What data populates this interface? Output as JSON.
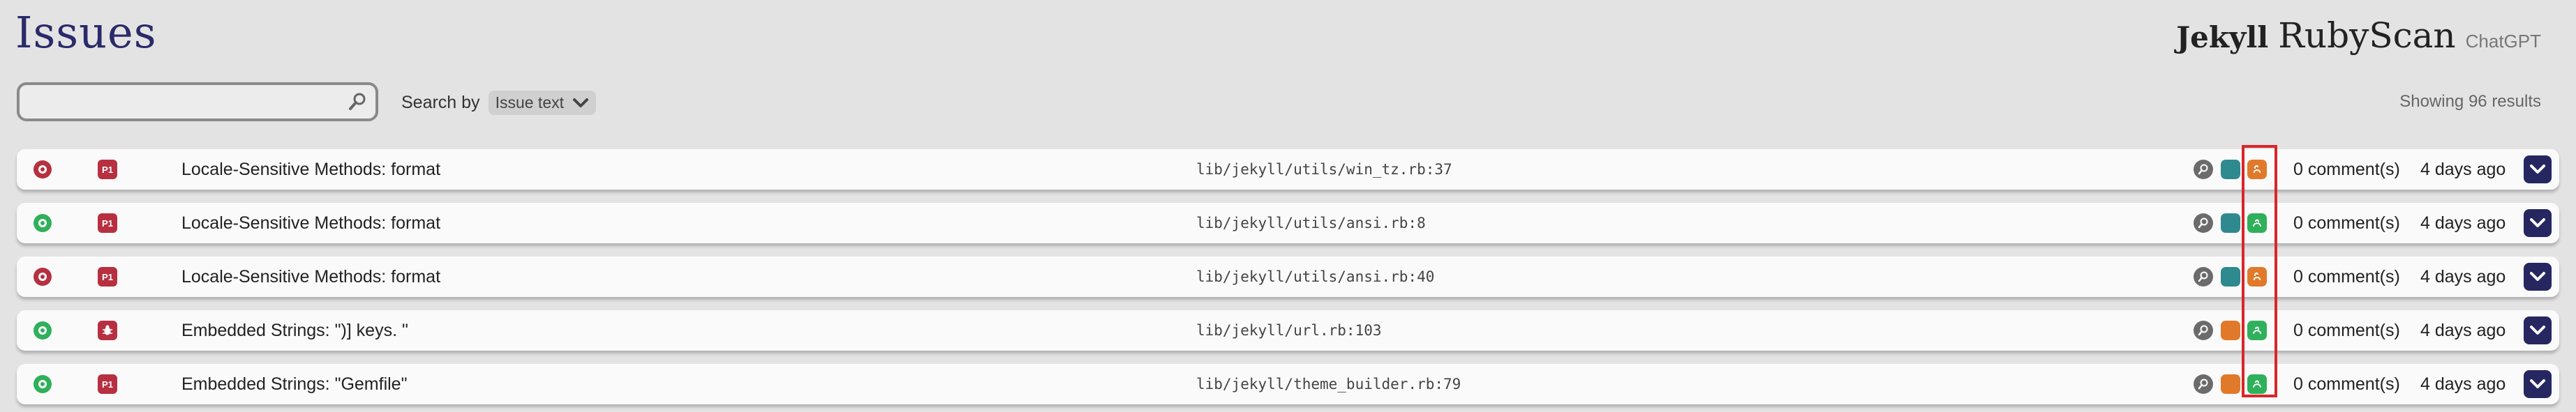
{
  "header": {
    "title": "Issues",
    "brand_jekyll": "Jekyll",
    "brand_rubyscan": "RubyScan",
    "brand_chatgpt": "ChatGPT"
  },
  "search": {
    "value": "",
    "placeholder": "",
    "search_by_label": "Search by",
    "search_by_selected": "Issue text"
  },
  "results_count": "Showing 96 results",
  "issues": [
    {
      "status": "closed",
      "priority": "P1",
      "title": "Locale-Sensitive Methods: format",
      "path": "lib/jekyll/utils/win_tz.rb:37",
      "tool_icons": [
        "magnify-icon",
        "teal-square-icon",
        "orange-snake-icon"
      ],
      "comments": "0 comment(s)",
      "age": "4 days ago"
    },
    {
      "status": "open",
      "priority": "P1",
      "title": "Locale-Sensitive Methods: format",
      "path": "lib/jekyll/utils/ansi.rb:8",
      "tool_icons": [
        "magnify-icon",
        "teal-square-icon",
        "green-snake-icon"
      ],
      "comments": "0 comment(s)",
      "age": "4 days ago"
    },
    {
      "status": "closed",
      "priority": "P1",
      "title": "Locale-Sensitive Methods: format",
      "path": "lib/jekyll/utils/ansi.rb:40",
      "tool_icons": [
        "magnify-icon",
        "teal-square-icon",
        "orange-snake-icon"
      ],
      "comments": "0 comment(s)",
      "age": "4 days ago"
    },
    {
      "status": "open",
      "priority": "bug",
      "title": "Embedded Strings: \")] keys. \"",
      "path": "lib/jekyll/url.rb:103",
      "tool_icons": [
        "magnify-icon",
        "orange-square-icon",
        "green-snake-icon"
      ],
      "comments": "0 comment(s)",
      "age": "4 days ago"
    },
    {
      "status": "open",
      "priority": "P1",
      "title": "Embedded Strings: \"Gemfile\"",
      "path": "lib/jekyll/theme_builder.rb:79",
      "tool_icons": [
        "magnify-icon",
        "orange-square-icon",
        "green-snake-icon"
      ],
      "comments": "0 comment(s)",
      "age": "4 days ago"
    }
  ],
  "colors": {
    "title": "#2a2a6a",
    "closed": "#b73040",
    "open": "#2fb05a",
    "teal": "#2f8a8f",
    "orange": "#e07a2a",
    "expand": "#262660",
    "highlight": "#d9262a"
  }
}
